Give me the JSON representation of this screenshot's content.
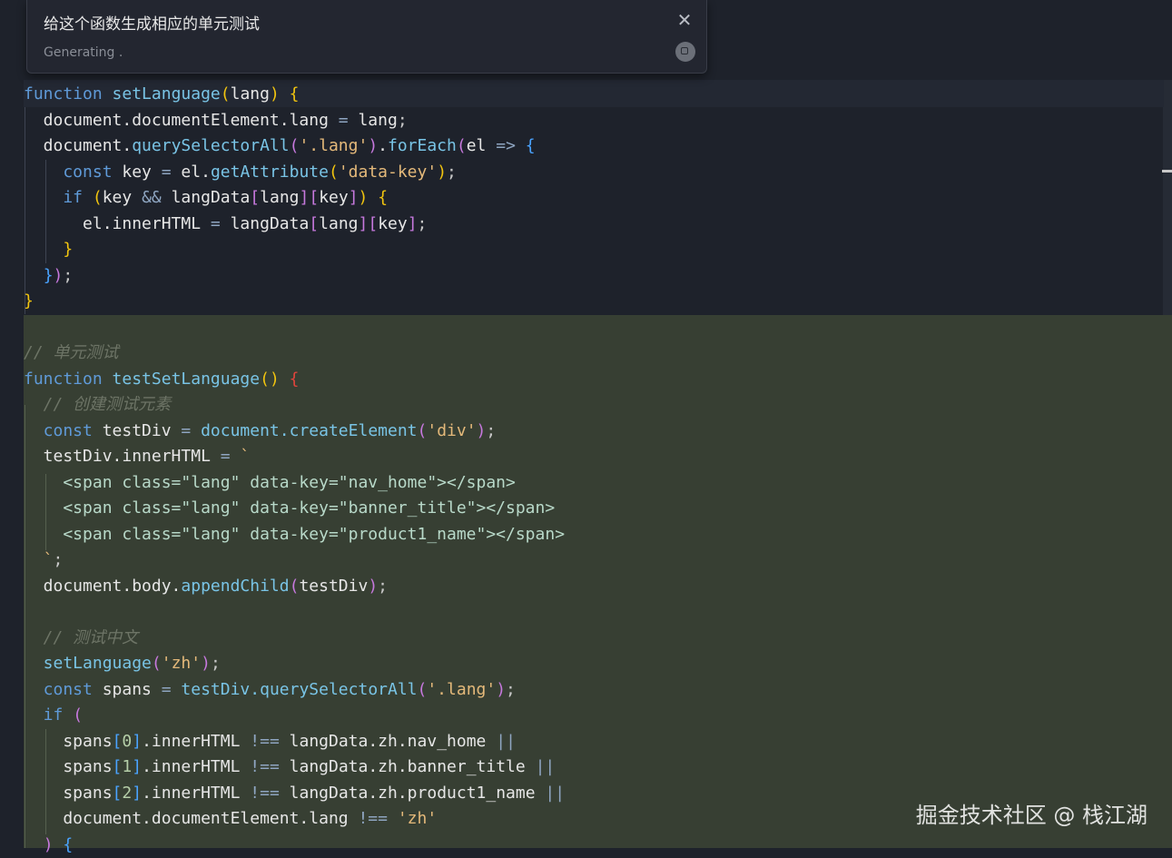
{
  "popup": {
    "prompt": "给这个函数生成相应的单元测试",
    "status": "Generating",
    "status_dots": ".",
    "close_glyph": "✕"
  },
  "watermark": "掘金技术社区 @ 栈江湖",
  "code": {
    "l1": {
      "t1": "function",
      "t2": " ",
      "t3": "setLanguage",
      "t4": "(",
      "t5": "lang",
      "t6": ")",
      "t7": " ",
      "t8": "{"
    },
    "l2": {
      "t1": "  document.documentElement.lang",
      "t2": " = ",
      "t3": "lang",
      "t4": ";"
    },
    "l3": {
      "t1": "  document.",
      "t2": "querySelectorAll",
      "t3": "(",
      "t4": "'.lang'",
      "t5": ")",
      ".t6": "",
      "t6": ".",
      "t7": "forEach",
      "t8": "(",
      "t9": "el",
      "t10": " => ",
      "t11": "{"
    },
    "l4": {
      "t1": "    const",
      "t2": " key",
      "t3": " = ",
      "t4": "el.",
      "t5": "getAttribute",
      "t6": "(",
      "t7": "'data-key'",
      "t8": ")",
      "t9": ";"
    },
    "l5": {
      "t1": "    if",
      "t2": " ",
      "t3": "(",
      "t4": "key",
      "t5": " && ",
      "t6": "langData",
      "t7": "[",
      "t8": "lang",
      "t9": "]",
      "t10": "[",
      "t11": "key",
      "t12": "]",
      "t13": ")",
      "t14": " ",
      "t15": "{"
    },
    "l6": {
      "t1": "      el.innerHTML",
      "t2": " = ",
      "t3": "langData",
      "t4": "[",
      "t5": "lang",
      "t6": "]",
      "t7": "[",
      "t8": "key",
      "t9": "]",
      "t10": ";"
    },
    "l7": {
      "t1": "    ",
      "t2": "}"
    },
    "l8": {
      "t1": "  ",
      "t2": "}",
      "t3": ")",
      "t4": ";"
    },
    "l9": {
      "t1": "}"
    },
    "g1": "// 单元测试",
    "g2": {
      "t1": "function",
      "t2": " ",
      "t3": "testSetLanguage",
      "t4": "()",
      "t5": " ",
      "t6": "{"
    },
    "g3": "  // 创建测试元素",
    "g4": {
      "t1": "  const",
      "t2": " testDiv",
      "t3": " = ",
      "t4": "document.",
      "t5": "createElement",
      "t6": "(",
      "t7": "'div'",
      "t8": ")",
      "t9": ";"
    },
    "g5": {
      "t1": "  testDiv.innerHTML",
      "t2": " = ",
      "t3": "`"
    },
    "g6": "    <span class=\"lang\" data-key=\"nav_home\"></span>",
    "g7": "    <span class=\"lang\" data-key=\"banner_title\"></span>",
    "g8": "    <span class=\"lang\" data-key=\"product1_name\"></span>",
    "g9": {
      "t1": "  `",
      "t2": ";"
    },
    "g10": {
      "t1": "  document.body.",
      "t2": "appendChild",
      "t3": "(",
      "t4": "testDiv",
      "t5": ")",
      "t6": ";"
    },
    "g11": "  // 测试中文",
    "g12": {
      "t1": "  setLanguage",
      "t2": "(",
      "t3": "'zh'",
      "t4": ")",
      "t5": ";"
    },
    "g13": {
      "t1": "  const",
      "t2": " spans",
      "t3": " = ",
      "t4": "testDiv.",
      "t5": "querySelectorAll",
      "t6": "(",
      "t7": "'.lang'",
      "t8": ")",
      "t9": ";"
    },
    "g14": {
      "t1": "  if",
      "t2": " ",
      "t3": "("
    },
    "g15": {
      "t1": "    spans",
      "t2": "[",
      "t3": "0",
      "t4": "]",
      "t5": ".innerHTML",
      "t6": " !== ",
      "t7": "langData.zh.nav_home",
      "t8": " ||"
    },
    "g16": {
      "t1": "    spans",
      "t2": "[",
      "t3": "1",
      "t4": "]",
      "t5": ".innerHTML",
      "t6": " !== ",
      "t7": "langData.zh.banner_title",
      "t8": " ||"
    },
    "g17": {
      "t1": "    spans",
      "t2": "[",
      "t3": "2",
      "t4": "]",
      "t5": ".innerHTML",
      "t6": " !== ",
      "t7": "langData.zh.product1_name",
      "t8": " ||"
    },
    "g18": {
      "t1": "    document.documentElement.lang",
      "t2": " !== ",
      "t3": "'zh'"
    },
    "g19": {
      "t1": "  ",
      "t2": ")",
      "t3": " ",
      "t4": "{"
    }
  },
  "colors": {
    "background": "#1e222b",
    "generated_background": "#373f33",
    "keyword": "#5f9ad8",
    "function": "#79c4e6",
    "string": "#e4b97a",
    "comment": "#6d7466"
  }
}
